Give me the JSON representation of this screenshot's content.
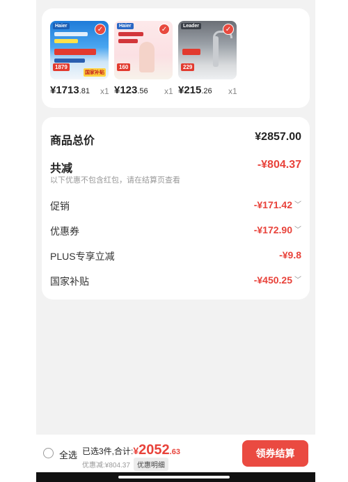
{
  "products": [
    {
      "brand": "Haier",
      "tag": "1879",
      "tag2": "国家补贴",
      "price_int": "¥1713",
      "price_dec": ".81",
      "qty": "x1"
    },
    {
      "brand": "Haier",
      "tag": "160",
      "tag2": "",
      "price_int": "¥123",
      "price_dec": ".56",
      "qty": "x1"
    },
    {
      "brand": "Leader",
      "tag": "229",
      "tag2": "",
      "price_int": "¥215",
      "price_dec": ".26",
      "qty": "x1"
    }
  ],
  "summary": {
    "total_label": "商品总价",
    "total_value": "¥2857.00",
    "reduce_label": "共减",
    "reduce_value": "-¥804.37",
    "reduce_note": "以下优惠不包含红包，请在结算页查看",
    "items": [
      {
        "label": "促销",
        "value": "-¥171.42",
        "expand": true
      },
      {
        "label": "优惠券",
        "value": "-¥172.90",
        "expand": true
      },
      {
        "label": "PLUS专享立减",
        "value": "-¥9.8",
        "expand": false
      },
      {
        "label": "国家补贴",
        "value": "-¥450.25",
        "expand": true
      }
    ]
  },
  "footer": {
    "select_all": "全选",
    "selected_text": "已选3件,合计:",
    "total_currency": "¥",
    "total_int": "2052",
    "total_dec": ".63",
    "discount_text": "优惠减:¥804.37",
    "detail_label": "优惠明细",
    "checkout_label": "领券结算"
  },
  "colors": {
    "accent": "#ea4a41",
    "discount": "#e8423a"
  }
}
